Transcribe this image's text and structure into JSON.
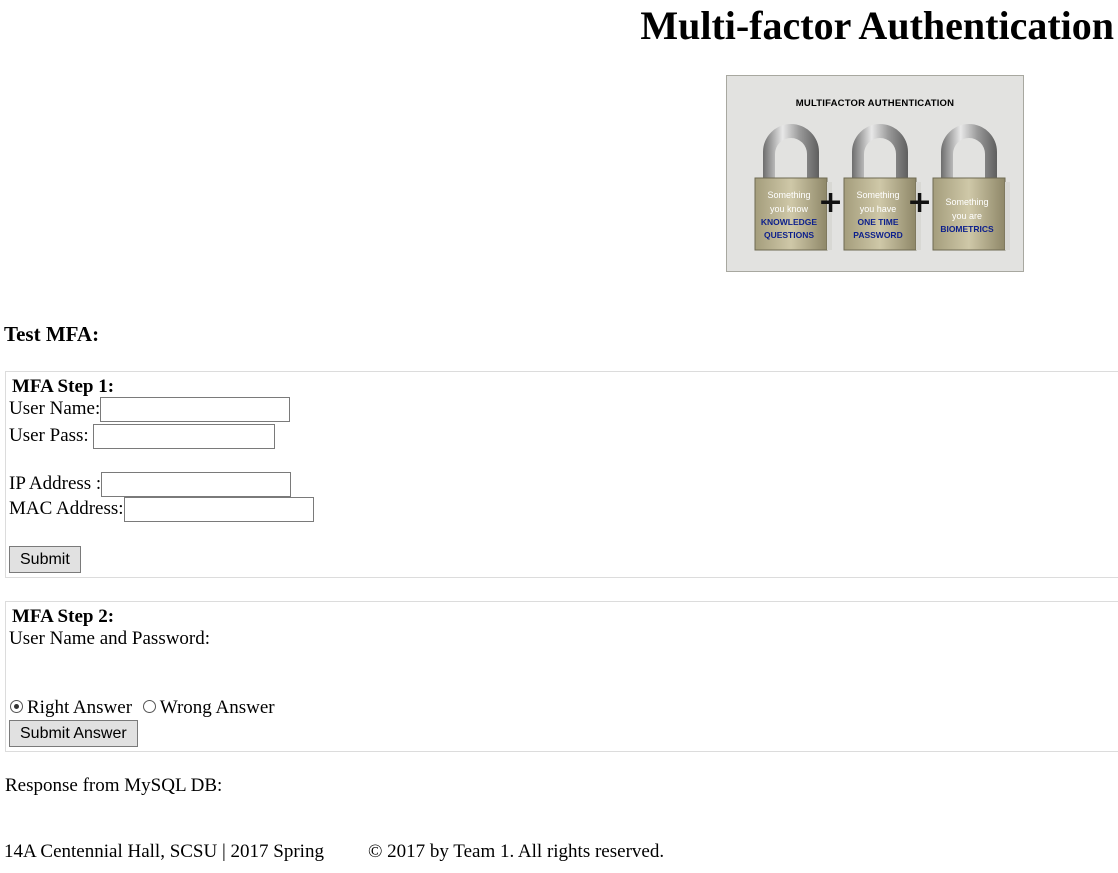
{
  "header": {
    "title": "Multi-factor Authentication"
  },
  "hero_image": {
    "caption": "MULTIFACTOR AUTHENTICATION",
    "locks": [
      {
        "line1": "Something",
        "line2": "you know",
        "line3": "KNOWLEDGE",
        "line4": "QUESTIONS"
      },
      {
        "line1": "Something",
        "line2": "you have",
        "line3": "ONE TIME",
        "line4": "PASSWORD"
      },
      {
        "line1": "Something",
        "line2": "you are",
        "line3": "BIOMETRICS",
        "line4": ""
      }
    ],
    "plus_sign": "+"
  },
  "test_section": {
    "title": "Test MFA:"
  },
  "step1": {
    "legend": "MFA Step 1:",
    "username_label": "User Name:",
    "username_value": "",
    "password_label": "User Pass:",
    "password_value": "",
    "ip_label": "IP Address :",
    "ip_value": "",
    "mac_label": "MAC Address:",
    "mac_value": "",
    "submit_label": "Submit"
  },
  "step2": {
    "legend": "MFA Step 2:",
    "prompt": "User Name and Password:",
    "options": [
      {
        "label": "Right Answer",
        "checked": true
      },
      {
        "label": "Wrong Answer",
        "checked": false
      }
    ],
    "submit_label": "Submit Answer"
  },
  "response": {
    "label": "Response from MySQL DB:"
  },
  "footer": {
    "location": "14A Centennial Hall, SCSU | 2017 Spring",
    "copyright": "© 2017 by Team 1. All rights reserved."
  },
  "colors": {
    "lock_body": "#c9c2a2",
    "lock_shackle": "#9a9a9a",
    "lock_accent_text": "#0c1f8c",
    "panel_border": "#dcdcdc",
    "button_bg": "#e1e1e1"
  }
}
